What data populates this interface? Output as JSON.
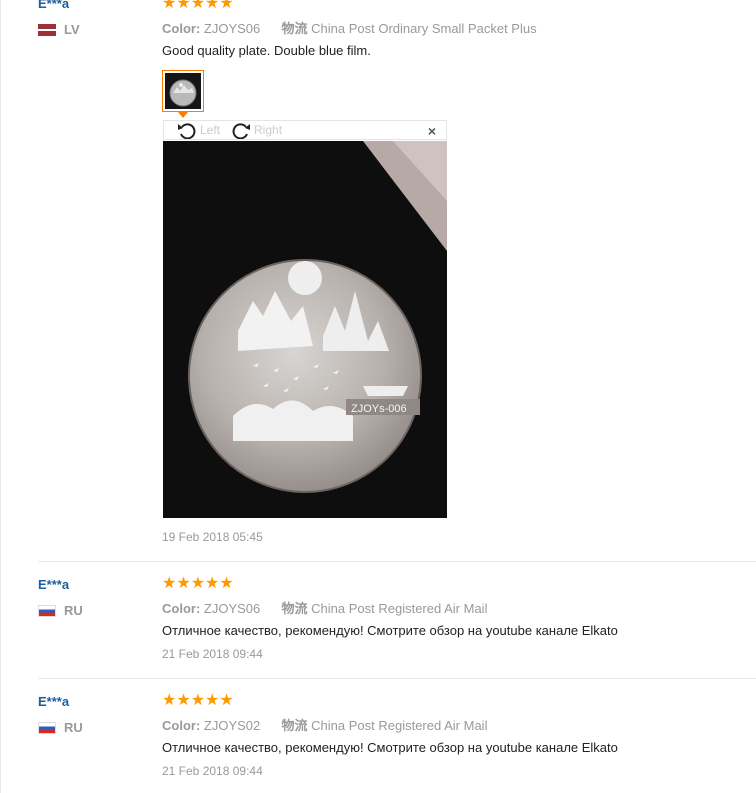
{
  "reviews": [
    {
      "user": "E***a",
      "country": "LV",
      "stars": "★★★★★",
      "color_label": "Color:",
      "color_value": "ZJOYS06",
      "shipping_label": "物流",
      "shipping_value": "China Post Ordinary Small Packet Plus",
      "text": "Good quality plate. Double blue film.",
      "date": "19 Feb 2018 05:45"
    },
    {
      "user": "E***a",
      "country": "RU",
      "stars": "★★★★★",
      "color_label": "Color:",
      "color_value": "ZJOYS06",
      "shipping_label": "物流",
      "shipping_value": "China Post Registered Air Mail",
      "text": "Отличное качество, рекомендую! Смотрите обзор на youtube канале Elkato",
      "date": "21 Feb 2018 09:44"
    },
    {
      "user": "E***a",
      "country": "RU",
      "stars": "★★★★★",
      "color_label": "Color:",
      "color_value": "ZJOYS02",
      "shipping_label": "物流",
      "shipping_value": "China Post Registered Air Mail",
      "text": "Отличное качество, рекомендую! Смотрите обзор на youtube канале Elkato",
      "date": "21 Feb 2018 09:44"
    }
  ],
  "viewer": {
    "rotate_left": "Left",
    "rotate_right": "Right",
    "close": "×",
    "plate_engraving": "ZJOYs-006"
  },
  "colors": {
    "star": "#ff9900",
    "username": "#1d5f9b",
    "thumb_border": "#ff7a00"
  }
}
